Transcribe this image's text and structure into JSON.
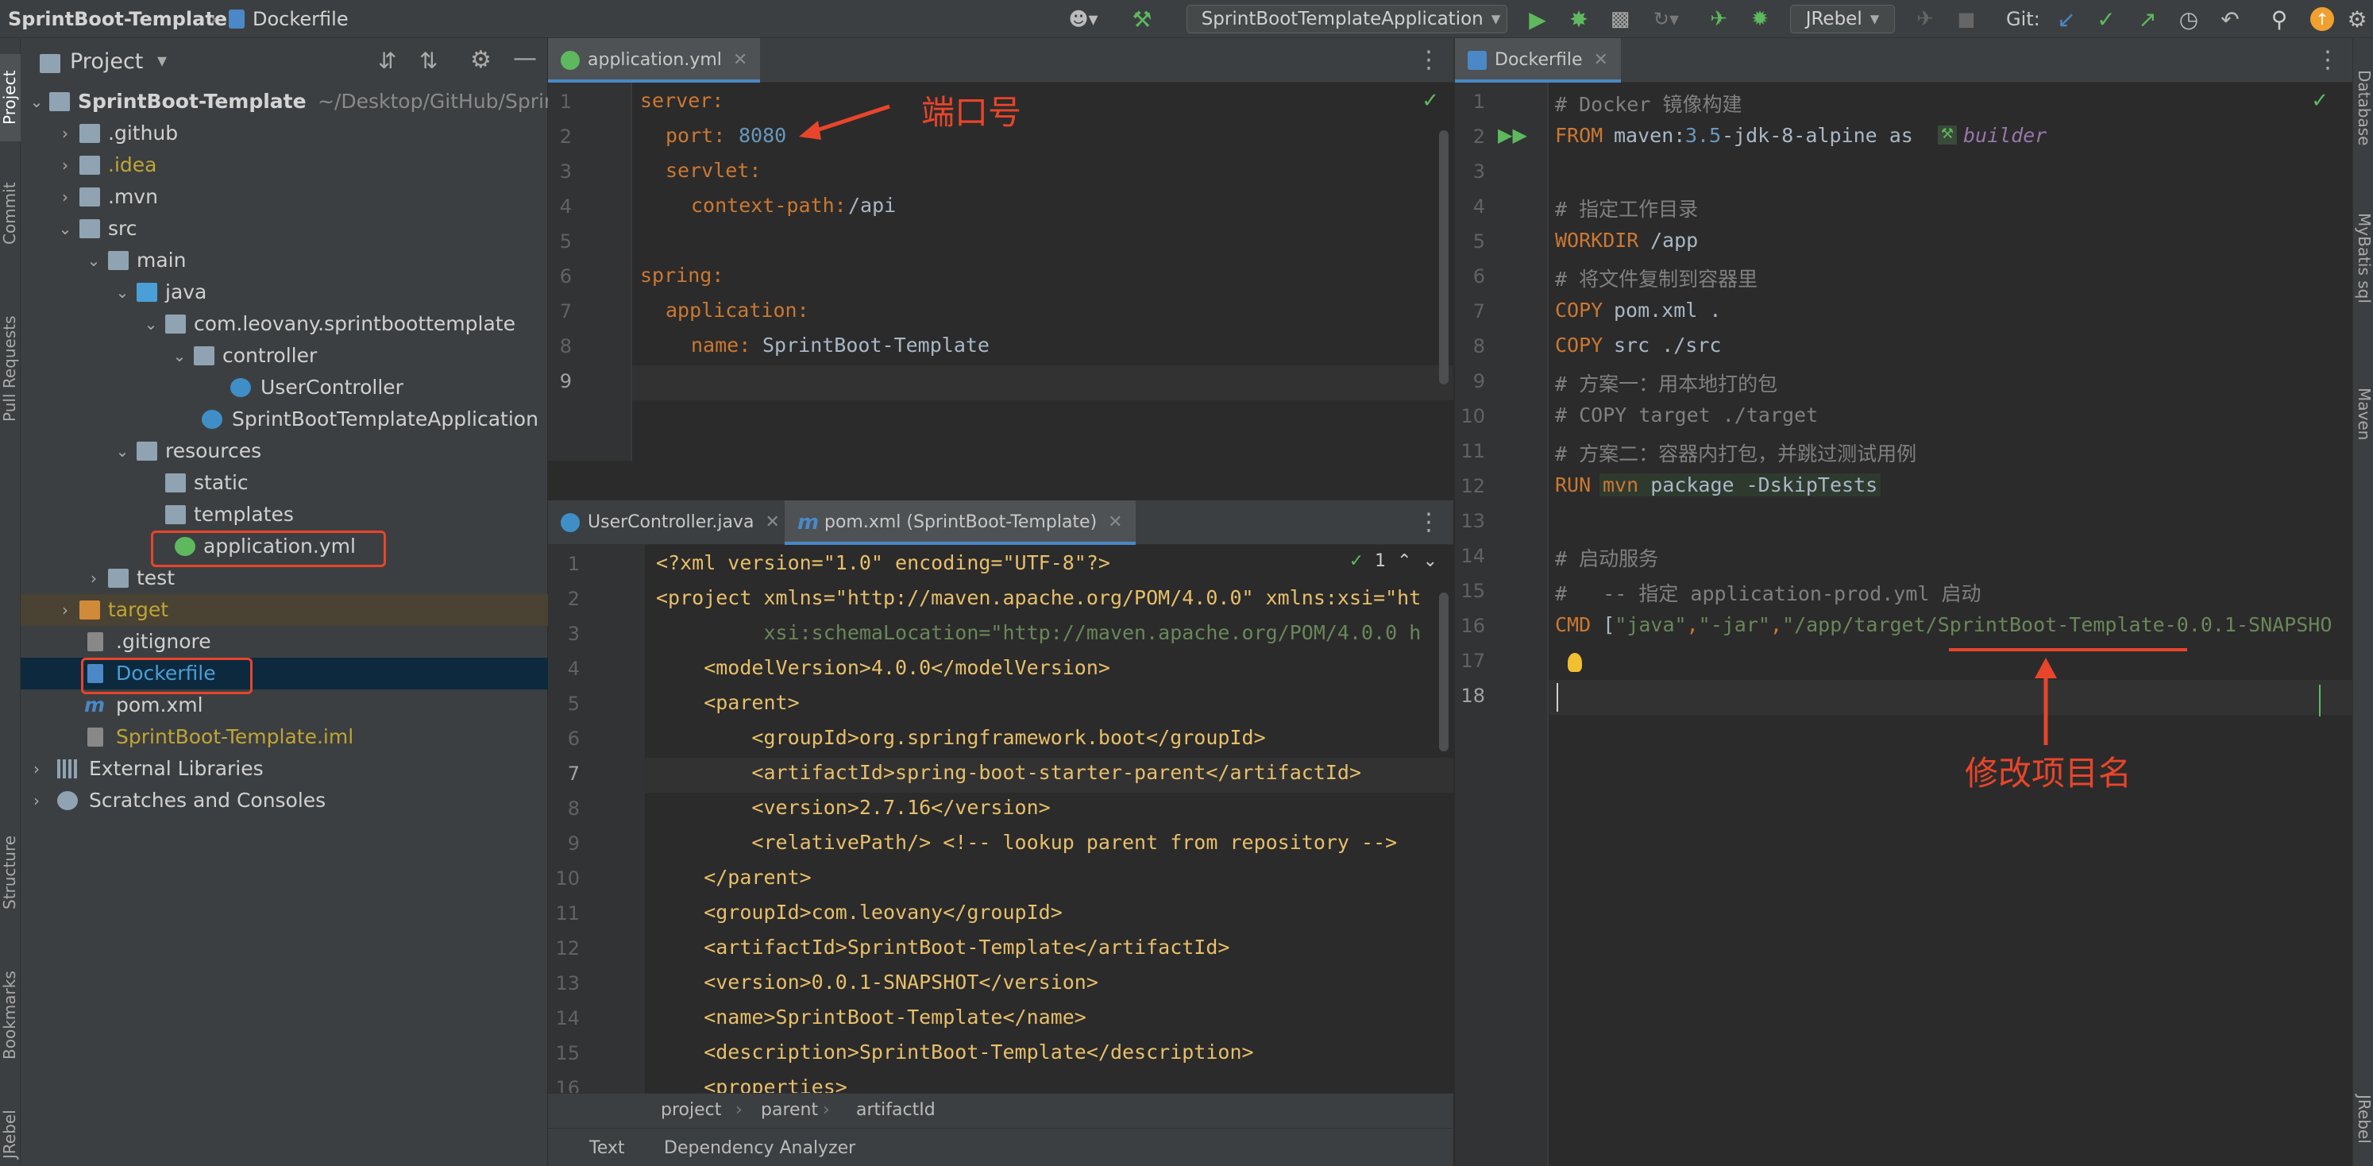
{
  "topbar": {
    "project_name": "SprintBoot-Template",
    "current_file": "Dockerfile",
    "run_config": "SprintBootTemplateApplication",
    "jrebel": "JRebel",
    "git_label": "Git:"
  },
  "left_stripe": {
    "tabs": [
      "Project",
      "Commit",
      "Pull Requests",
      "Structure",
      "Bookmarks",
      "JRebel"
    ]
  },
  "right_stripe": {
    "tabs": [
      "Database",
      "MyBatis sql",
      "Maven",
      "JRebel"
    ]
  },
  "project_panel": {
    "title": "Project",
    "root": {
      "name": "SprintBoot-Template",
      "path": "~/Desktop/GitHub/Sprin"
    },
    "items": [
      {
        "label": ".github"
      },
      {
        "label": ".idea"
      },
      {
        "label": ".mvn"
      },
      {
        "label": "src"
      },
      {
        "label": "main"
      },
      {
        "label": "java"
      },
      {
        "label": "com.leovany.sprintboottemplate"
      },
      {
        "label": "controller"
      },
      {
        "label": "UserController"
      },
      {
        "label": "SprintBootTemplateApplication"
      },
      {
        "label": "resources"
      },
      {
        "label": "static"
      },
      {
        "label": "templates"
      },
      {
        "label": "application.yml"
      },
      {
        "label": "test"
      },
      {
        "label": "target"
      },
      {
        "label": ".gitignore"
      },
      {
        "label": "Dockerfile"
      },
      {
        "label": "pom.xml"
      },
      {
        "label": "SprintBoot-Template.iml"
      },
      {
        "label": "External Libraries"
      },
      {
        "label": "Scratches and Consoles"
      }
    ]
  },
  "yml_editor": {
    "tab": "application.yml",
    "lines": [
      "1",
      "2",
      "3",
      "4",
      "5",
      "6",
      "7",
      "8",
      "9"
    ],
    "code": {
      "server_key": "server:",
      "port_key": "port:",
      "port_val": "8080",
      "servlet_key": "servlet:",
      "context_key": "context-path:",
      "context_val": "/api",
      "spring_key": "spring:",
      "app_key": "application:",
      "name_key": "name:",
      "name_val": "SprintBoot-Template"
    },
    "annotation": "端口号"
  },
  "pom_editor": {
    "tabs": [
      "UserController.java",
      "pom.xml (SprintBoot-Template)"
    ],
    "inspection_count": "1",
    "lines": [
      "1",
      "2",
      "3",
      "4",
      "5",
      "6",
      "7",
      "8",
      "9",
      "10",
      "11",
      "12",
      "13",
      "14",
      "15",
      "16"
    ],
    "code": [
      "<?xml version=\"1.0\" encoding=\"UTF-8\"?>",
      "<project xmlns=\"http://maven.apache.org/POM/4.0.0\" xmlns:xsi=\"ht",
      "         xsi:schemaLocation=\"http://maven.apache.org/POM/4.0.0 h",
      "    <modelVersion>4.0.0</modelVersion>",
      "    <parent>",
      "        <groupId>org.springframework.boot</groupId>",
      "        <artifactId>spring-boot-starter-parent</artifactId>",
      "        <version>2.7.16</version>",
      "        <relativePath/> <!-- lookup parent from repository -->",
      "    </parent>",
      "    <groupId>com.leovany</groupId>",
      "    <artifactId>SprintBoot-Template</artifactId>",
      "    <version>0.0.1-SNAPSHOT</version>",
      "    <name>SprintBoot-Template</name>",
      "    <description>SprintBoot-Template</description>",
      "    <properties>"
    ],
    "breadcrumb": [
      "project",
      "parent",
      "artifactId"
    ],
    "bottom_tabs": [
      "Text",
      "Dependency Analyzer"
    ]
  },
  "docker_editor": {
    "tab": "Dockerfile",
    "lines": [
      "1",
      "2",
      "3",
      "4",
      "5",
      "6",
      "7",
      "8",
      "9",
      "10",
      "11",
      "12",
      "13",
      "14",
      "15",
      "16",
      "17",
      "18"
    ],
    "code": {
      "l1": "# Docker 镜像构建",
      "l2_kw": "FROM",
      "l2_img": "maven:",
      "l2_ver": "3.5",
      "l2_rest": "-jdk-8-alpine as",
      "l2_alias": "builder",
      "l4": "# 指定工作目录",
      "l5_kw": "WORKDIR",
      "l5_val": "/app",
      "l6": "# 将文件复制到容器里",
      "l7_kw": "COPY",
      "l7_val": "pom.xml .",
      "l8_kw": "COPY",
      "l8_val": "src ./src",
      "l9": "# 方案一：用本地打的包",
      "l10": "# COPY target ./target",
      "l11": "# 方案二：容器内打包，并跳过测试用例",
      "l12_kw": "RUN",
      "l12_cmd": "mvn",
      "l12_val": "package -DskipTests",
      "l14": "# 启动服务",
      "l15": "#   -- 指定 application-prod.yml 启动",
      "l16_kw": "CMD",
      "l16_a": "[",
      "l16_s1": "\"java\"",
      "l16_comma1": ",",
      "l16_s2": "\"-jar\"",
      "l16_comma2": ",",
      "l16_s3": "\"/app/target/SprintBoot-Template-0.0.1-SNAPSHO"
    },
    "annotation": "修改项目名"
  },
  "colors": {
    "annotation": "#e8452b",
    "keyword": "#cc7832",
    "string": "#6a8759",
    "number": "#6897bb",
    "tag": "#e8bf6a",
    "comment": "#808080"
  }
}
